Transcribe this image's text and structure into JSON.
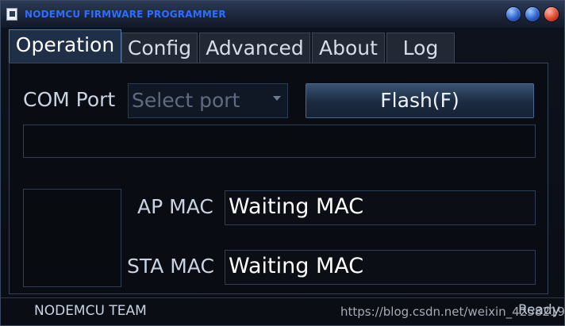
{
  "window": {
    "title": "NODEMCU FIRMWARE PROGRAMMER"
  },
  "tabs": [
    {
      "label": "Operation",
      "active": true
    },
    {
      "label": "Config"
    },
    {
      "label": "Advanced"
    },
    {
      "label": "About"
    },
    {
      "label": "Log"
    }
  ],
  "operation": {
    "com_port_label": "COM Port",
    "com_port_placeholder": "Select port",
    "flash_button_label": "Flash(F)",
    "ap_mac_label": "AP MAC",
    "ap_mac_value": "Waiting MAC",
    "sta_mac_label": "STA MAC",
    "sta_mac_value": "Waiting MAC"
  },
  "status": {
    "team": "NODEMCU TEAM",
    "ready": "Ready",
    "watermark": "https://blog.csdn.net/weixin_42582190"
  },
  "colors": {
    "title_text": "#2f6cff",
    "active_tab": "#1e2f47",
    "close_button": "#e0452a",
    "minimize_button": "#2c5fcc"
  },
  "icons": [
    "app-icon",
    "minimize-icon",
    "maximize-icon",
    "close-icon",
    "chevron-down-icon"
  ]
}
